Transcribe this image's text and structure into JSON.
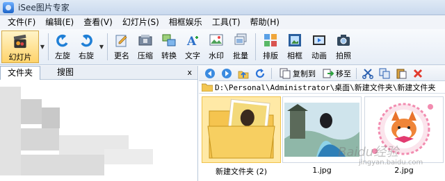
{
  "window": {
    "title": "iSee图片专家"
  },
  "menu": [
    "文件(F)",
    "编辑(E)",
    "查看(V)",
    "幻灯片(S)",
    "相框娱乐",
    "工具(T)",
    "帮助(H)"
  ],
  "toolbar": {
    "slideshow": "幻灯片",
    "rotate_left": "左旋",
    "rotate_right": "右旋",
    "rename": "更名",
    "compress": "压缩",
    "convert": "转换",
    "text": "文字",
    "watermark": "水印",
    "batch": "批量",
    "layout": "排版",
    "frame": "相框",
    "animation": "动画",
    "capture": "拍照"
  },
  "left_panel": {
    "tabs": [
      "文件夹",
      "搜图"
    ],
    "close": "x"
  },
  "nav": {
    "copy_to": "复制到",
    "move_to": "移至"
  },
  "path": "D:\\Personal\\Administrator\\桌面\\新建文件夹\\新建文件夹",
  "files": [
    {
      "name": "新建文件夹 (2)",
      "type": "folder",
      "icon": "folder-icon"
    },
    {
      "name": "1.jpg",
      "type": "image"
    },
    {
      "name": "2.jpg",
      "type": "image"
    }
  ],
  "watermark": {
    "logo": "Baidu经验",
    "url": "jingyan.baidu.com"
  },
  "colors": {
    "selected": "#ffe9a6",
    "accent": "#2a73d9",
    "titlebar": "#dfe9f5"
  }
}
